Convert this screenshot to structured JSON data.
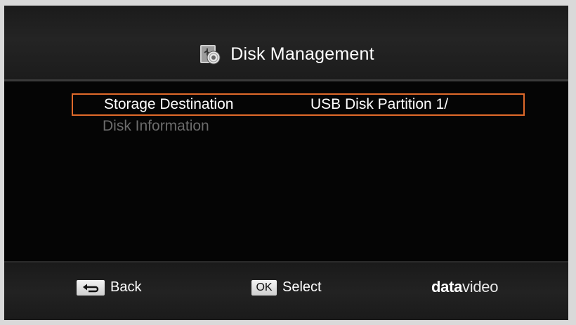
{
  "header": {
    "title": "Disk Management",
    "icon": "usb-disk-icon"
  },
  "menu": {
    "items": [
      {
        "label": "Storage Destination",
        "value": "USB Disk Partition 1/",
        "selected": true
      },
      {
        "label": "Disk Information",
        "value": "",
        "selected": false
      }
    ],
    "selection_color": "#e06a2a"
  },
  "footer": {
    "back": {
      "key_icon": "return-arrow-icon",
      "label": "Back"
    },
    "select": {
      "key_label": "OK",
      "label": "Select"
    },
    "logo": {
      "part1": "data",
      "part2": "video"
    }
  }
}
